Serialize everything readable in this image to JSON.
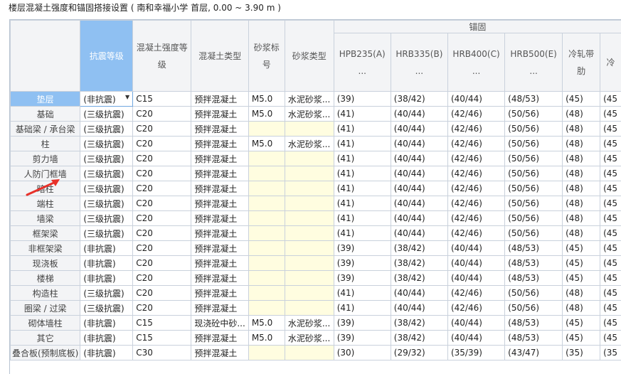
{
  "title": "楼层混凝土强度和锚固搭接设置 ( 南和幸福小学  首层, 0.00 ~ 3.90 m )",
  "headers": {
    "seismic": "抗震等级",
    "concrete_grade": "混凝土强度等级",
    "concrete_type": "混凝土类型",
    "mortar_grade": "砂浆标号",
    "mortar_type": "砂浆类型",
    "anchor_group": "锚固",
    "anchor_cols": [
      "HPB235(A)\n...",
      "HRB335(B)\n...",
      "HRB400(C)\n...",
      "HRB500(E)\n...",
      "冷轧带肋",
      "冷"
    ]
  },
  "rows": [
    {
      "name": "垫层",
      "seismic": "(非抗震)",
      "grade": "C15",
      "ctype": "预拌混凝土",
      "mgrade": "M5.0",
      "mtype": "水泥砂浆...",
      "a": [
        "(39)",
        "(38/42)",
        "(40/44)",
        "(48/53)",
        "(45)",
        "(45"
      ]
    },
    {
      "name": "基础",
      "seismic": "(三级抗震)",
      "grade": "C20",
      "ctype": "预拌混凝土",
      "mgrade": "M5.0",
      "mtype": "水泥砂浆...",
      "a": [
        "(41)",
        "(40/44)",
        "(42/46)",
        "(50/56)",
        "(48)",
        "(45"
      ]
    },
    {
      "name": "基础梁 / 承台梁",
      "seismic": "(三级抗震)",
      "grade": "C20",
      "ctype": "预拌混凝土",
      "mgrade": "",
      "mtype": "",
      "a": [
        "(41)",
        "(40/44)",
        "(42/46)",
        "(50/56)",
        "(48)",
        "(45"
      ]
    },
    {
      "name": "柱",
      "seismic": "(三级抗震)",
      "grade": "C20",
      "ctype": "预拌混凝土",
      "mgrade": "M5.0",
      "mtype": "水泥砂浆...",
      "a": [
        "(41)",
        "(40/44)",
        "(42/46)",
        "(50/56)",
        "(48)",
        "(45"
      ]
    },
    {
      "name": "剪力墙",
      "seismic": "(三级抗震)",
      "grade": "C20",
      "ctype": "预拌混凝土",
      "mgrade": "",
      "mtype": "",
      "a": [
        "(41)",
        "(40/44)",
        "(42/46)",
        "(50/56)",
        "(48)",
        "(45"
      ]
    },
    {
      "name": "人防门框墙",
      "seismic": "(三级抗震)",
      "grade": "C20",
      "ctype": "预拌混凝土",
      "mgrade": "",
      "mtype": "",
      "a": [
        "(41)",
        "(40/44)",
        "(42/46)",
        "(50/56)",
        "(48)",
        "(45"
      ]
    },
    {
      "name": "暗柱",
      "seismic": "(三级抗震)",
      "grade": "C20",
      "ctype": "预拌混凝土",
      "mgrade": "",
      "mtype": "",
      "a": [
        "(41)",
        "(40/44)",
        "(42/46)",
        "(50/56)",
        "(48)",
        "(45"
      ]
    },
    {
      "name": "端柱",
      "seismic": "(三级抗震)",
      "grade": "C20",
      "ctype": "预拌混凝土",
      "mgrade": "",
      "mtype": "",
      "a": [
        "(41)",
        "(40/44)",
        "(42/46)",
        "(50/56)",
        "(48)",
        "(45"
      ]
    },
    {
      "name": "墙梁",
      "seismic": "(三级抗震)",
      "grade": "C20",
      "ctype": "预拌混凝土",
      "mgrade": "",
      "mtype": "",
      "a": [
        "(41)",
        "(40/44)",
        "(42/46)",
        "(50/56)",
        "(48)",
        "(45"
      ]
    },
    {
      "name": "框架梁",
      "seismic": "(三级抗震)",
      "grade": "C20",
      "ctype": "预拌混凝土",
      "mgrade": "",
      "mtype": "",
      "a": [
        "(41)",
        "(40/44)",
        "(42/46)",
        "(50/56)",
        "(48)",
        "(45"
      ]
    },
    {
      "name": "非框架梁",
      "seismic": "(非抗震)",
      "grade": "C20",
      "ctype": "预拌混凝土",
      "mgrade": "",
      "mtype": "",
      "a": [
        "(39)",
        "(38/42)",
        "(40/44)",
        "(48/53)",
        "(45)",
        "(45"
      ]
    },
    {
      "name": "现浇板",
      "seismic": "(非抗震)",
      "grade": "C20",
      "ctype": "预拌混凝土",
      "mgrade": "",
      "mtype": "",
      "a": [
        "(39)",
        "(38/42)",
        "(40/44)",
        "(48/53)",
        "(45)",
        "(45"
      ]
    },
    {
      "name": "楼梯",
      "seismic": "(非抗震)",
      "grade": "C20",
      "ctype": "预拌混凝土",
      "mgrade": "",
      "mtype": "",
      "a": [
        "(39)",
        "(38/42)",
        "(40/44)",
        "(48/53)",
        "(45)",
        "(45"
      ]
    },
    {
      "name": "构造柱",
      "seismic": "(三级抗震)",
      "grade": "C20",
      "ctype": "预拌混凝土",
      "mgrade": "",
      "mtype": "",
      "a": [
        "(41)",
        "(40/44)",
        "(42/46)",
        "(50/56)",
        "(48)",
        "(45"
      ]
    },
    {
      "name": "圈梁 / 过梁",
      "seismic": "(三级抗震)",
      "grade": "C20",
      "ctype": "预拌混凝土",
      "mgrade": "",
      "mtype": "",
      "a": [
        "(41)",
        "(40/44)",
        "(42/46)",
        "(50/56)",
        "(48)",
        "(45"
      ]
    },
    {
      "name": "砌体墙柱",
      "seismic": "(非抗震)",
      "grade": "C15",
      "ctype": "现浇砼中砂...",
      "mgrade": "M5.0",
      "mtype": "水泥砂浆...",
      "a": [
        "(39)",
        "(38/42)",
        "(40/44)",
        "(48/53)",
        "(45)",
        "(45"
      ]
    },
    {
      "name": "其它",
      "seismic": "(非抗震)",
      "grade": "C15",
      "ctype": "预拌混凝土",
      "mgrade": "M5.0",
      "mtype": "水泥砂浆...",
      "a": [
        "(39)",
        "(38/42)",
        "(40/44)",
        "(48/53)",
        "(45)",
        "(45"
      ]
    },
    {
      "name": "叠合板(预制底板)",
      "seismic": "(非抗震)",
      "grade": "C30",
      "ctype": "预拌混凝土",
      "mgrade": "",
      "mtype": "",
      "a": [
        "(30)",
        "(29/32)",
        "(35/39)",
        "(43/47)",
        "(35)",
        "(35"
      ]
    }
  ],
  "colors": {
    "selected_header": "#8fc0f2",
    "empty_mortar": "#fffde0",
    "arrow": "#e8312a"
  },
  "icons": {
    "dropdown": "chevron-down-icon",
    "annotation": "red-arrow-icon"
  }
}
